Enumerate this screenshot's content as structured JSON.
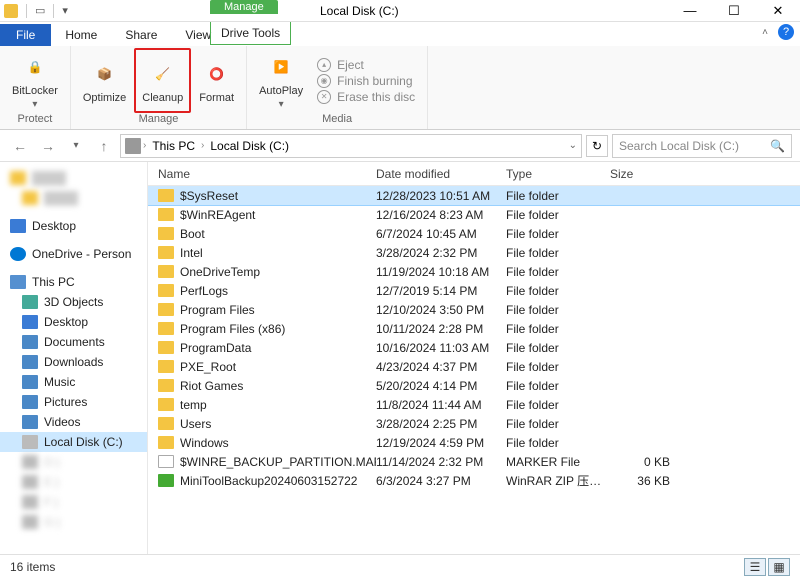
{
  "title": "Local Disk (C:)",
  "context_tab_header": "Manage",
  "tabs": {
    "file": "File",
    "home": "Home",
    "share": "Share",
    "view": "View",
    "drive_tools": "Drive Tools"
  },
  "ribbon": {
    "protect": {
      "bitlocker": "BitLocker",
      "label": "Protect"
    },
    "manage": {
      "optimize": "Optimize",
      "cleanup": "Cleanup",
      "format": "Format",
      "label": "Manage"
    },
    "media": {
      "autoplay": "AutoPlay",
      "eject": "Eject",
      "finish": "Finish burning",
      "erase": "Erase this disc",
      "label": "Media"
    }
  },
  "breadcrumb": {
    "pc": "This PC",
    "drive": "Local Disk (C:)"
  },
  "search_placeholder": "Search Local Disk (C:)",
  "sidebar": {
    "desktop": "Desktop",
    "onedrive": "OneDrive - Person",
    "thispc": "This PC",
    "threed": "3D Objects",
    "desk2": "Desktop",
    "docs": "Documents",
    "downloads": "Downloads",
    "music": "Music",
    "pictures": "Pictures",
    "videos": "Videos",
    "local": "Local Disk (C:)",
    "d": "D:)",
    "e": "E:)",
    "f": "F:)",
    "g": "G:)"
  },
  "columns": {
    "name": "Name",
    "date": "Date modified",
    "type": "Type",
    "size": "Size"
  },
  "files": [
    {
      "name": "$SysReset",
      "date": "12/28/2023 10:51 AM",
      "type": "File folder",
      "size": "",
      "icon": "ic-fold",
      "sel": true
    },
    {
      "name": "$WinREAgent",
      "date": "12/16/2024 8:23 AM",
      "type": "File folder",
      "size": "",
      "icon": "ic-fold"
    },
    {
      "name": "Boot",
      "date": "6/7/2024 10:45 AM",
      "type": "File folder",
      "size": "",
      "icon": "ic-fold"
    },
    {
      "name": "Intel",
      "date": "3/28/2024 2:32 PM",
      "type": "File folder",
      "size": "",
      "icon": "ic-fold"
    },
    {
      "name": "OneDriveTemp",
      "date": "11/19/2024 10:18 AM",
      "type": "File folder",
      "size": "",
      "icon": "ic-fold"
    },
    {
      "name": "PerfLogs",
      "date": "12/7/2019 5:14 PM",
      "type": "File folder",
      "size": "",
      "icon": "ic-fold"
    },
    {
      "name": "Program Files",
      "date": "12/10/2024 3:50 PM",
      "type": "File folder",
      "size": "",
      "icon": "ic-fold"
    },
    {
      "name": "Program Files (x86)",
      "date": "10/11/2024 2:28 PM",
      "type": "File folder",
      "size": "",
      "icon": "ic-fold"
    },
    {
      "name": "ProgramData",
      "date": "10/16/2024 11:03 AM",
      "type": "File folder",
      "size": "",
      "icon": "ic-fold"
    },
    {
      "name": "PXE_Root",
      "date": "4/23/2024 4:37 PM",
      "type": "File folder",
      "size": "",
      "icon": "ic-fold"
    },
    {
      "name": "Riot Games",
      "date": "5/20/2024 4:14 PM",
      "type": "File folder",
      "size": "",
      "icon": "ic-fold"
    },
    {
      "name": "temp",
      "date": "11/8/2024 11:44 AM",
      "type": "File folder",
      "size": "",
      "icon": "ic-fold"
    },
    {
      "name": "Users",
      "date": "3/28/2024 2:25 PM",
      "type": "File folder",
      "size": "",
      "icon": "ic-fold"
    },
    {
      "name": "Windows",
      "date": "12/19/2024 4:59 PM",
      "type": "File folder",
      "size": "",
      "icon": "ic-fold"
    },
    {
      "name": "$WINRE_BACKUP_PARTITION.MARKER",
      "date": "11/14/2024 2:32 PM",
      "type": "MARKER File",
      "size": "0 KB",
      "icon": "ic-file"
    },
    {
      "name": "MiniToolBackup20240603152722",
      "date": "6/3/2024 3:27 PM",
      "type": "WinRAR ZIP 压缩...",
      "size": "36 KB",
      "icon": "ic-rar"
    }
  ],
  "status": "16 items"
}
